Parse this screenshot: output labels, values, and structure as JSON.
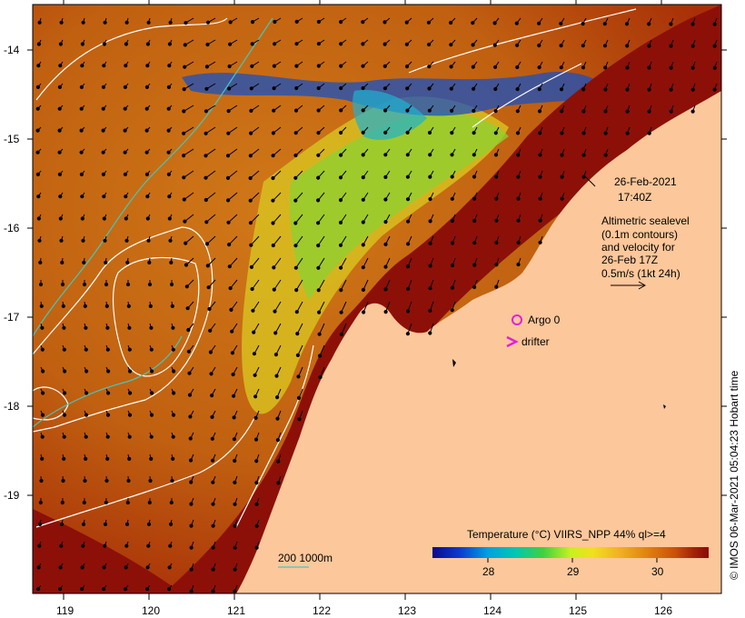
{
  "info": {
    "date": "26-Feb-2021",
    "time": "17:40Z",
    "altimetry_lines": [
      "Altimetric sealevel",
      "(0.1m contours)",
      "and velocity for",
      "26-Feb 17Z",
      "0.5m/s (1kt 24h)"
    ]
  },
  "legend": {
    "argo": "Argo 0",
    "drifter": "drifter",
    "depth_contours": "200  1000m"
  },
  "colorbar": {
    "title": "Temperature (°C) VIIRS_NPP 44% ql>=4",
    "ticks": [
      "28",
      "29",
      "30"
    ],
    "colors": [
      "#0a0a8a",
      "#0a3cd0",
      "#00a0e0",
      "#00c8b0",
      "#40d040",
      "#c8f020",
      "#f0e020",
      "#f0b020",
      "#e08010",
      "#c85008",
      "#a02008",
      "#8a0a0a"
    ]
  },
  "axes": {
    "lon_ticks": [
      "119",
      "120",
      "121",
      "122",
      "123",
      "124",
      "125",
      "126"
    ],
    "lat_ticks": [
      "-14",
      "-15",
      "-16",
      "-17",
      "-18",
      "-19"
    ]
  },
  "credit": "© IMOS 06-Mar-2021 05:04:23 Hobart time",
  "colors": {
    "land": "#fcc79a",
    "warm_sea": "#c86a10",
    "hot_sea": "#8a0a0a",
    "contour": "#ffffff",
    "depth_line": "#40c8c0",
    "argo": "#e020e0"
  }
}
